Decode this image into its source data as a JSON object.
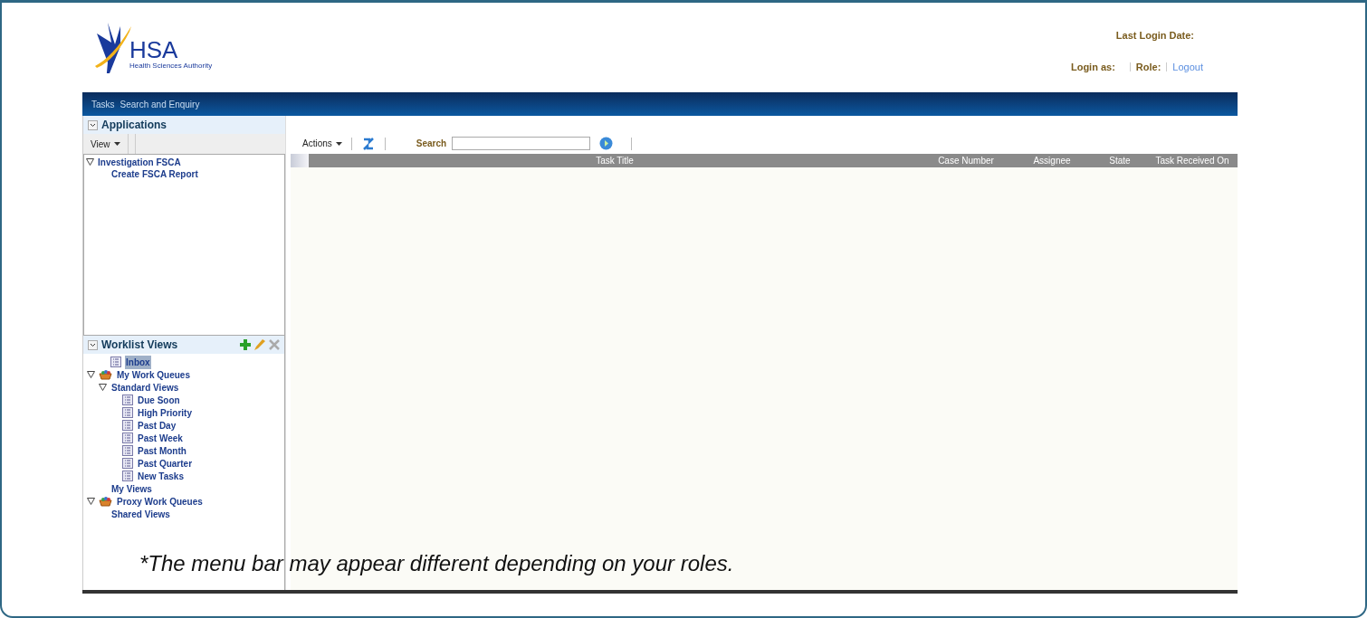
{
  "logo": {
    "name": "HSA",
    "subtitle": "Health Sciences Authority"
  },
  "header": {
    "last_login": "Last Login Date:",
    "login_as": "Login as:",
    "role": "Role:",
    "logout": "Logout"
  },
  "menu_bar": [
    "Tasks",
    "Search and Enquiry"
  ],
  "applications": {
    "title": "Applications",
    "view_menu": "View",
    "tree": [
      {
        "label": "Investigation FSCA",
        "expanded": true,
        "children": [
          {
            "label": "Create FSCA Report"
          }
        ]
      }
    ]
  },
  "worklist_views": {
    "title": "Worklist Views",
    "tree": [
      {
        "label": "Inbox",
        "kind": "view",
        "selected": true
      },
      {
        "label": "My Work Queues",
        "kind": "queue",
        "selected": false,
        "expanded": true,
        "children": [
          {
            "label": "Standard Views",
            "selected": false,
            "expanded": true,
            "children": [
              {
                "label": "Due Soon",
                "kind": "view",
                "selected": false
              },
              {
                "label": "High Priority",
                "kind": "view",
                "selected": false
              },
              {
                "label": "Past Day",
                "kind": "view",
                "selected": false
              },
              {
                "label": "Past Week",
                "kind": "view",
                "selected": false
              },
              {
                "label": "Past Month",
                "kind": "view",
                "selected": false
              },
              {
                "label": "Past Quarter",
                "kind": "view",
                "selected": false
              },
              {
                "label": "New Tasks",
                "kind": "view",
                "selected": false
              }
            ]
          },
          {
            "label": "My Views",
            "selected": false
          }
        ]
      },
      {
        "label": "Proxy Work Queues",
        "kind": "queue",
        "selected": false,
        "expanded": true,
        "children": [
          {
            "label": "Shared Views",
            "selected": false
          }
        ]
      }
    ]
  },
  "toolbar": {
    "actions": "Actions",
    "search_label": "Search"
  },
  "table": {
    "columns": [
      "Task Title",
      "Case Number",
      "Assignee",
      "State",
      "Task Received On"
    ]
  },
  "caption": "*The menu bar may appear different depending on your roles."
}
